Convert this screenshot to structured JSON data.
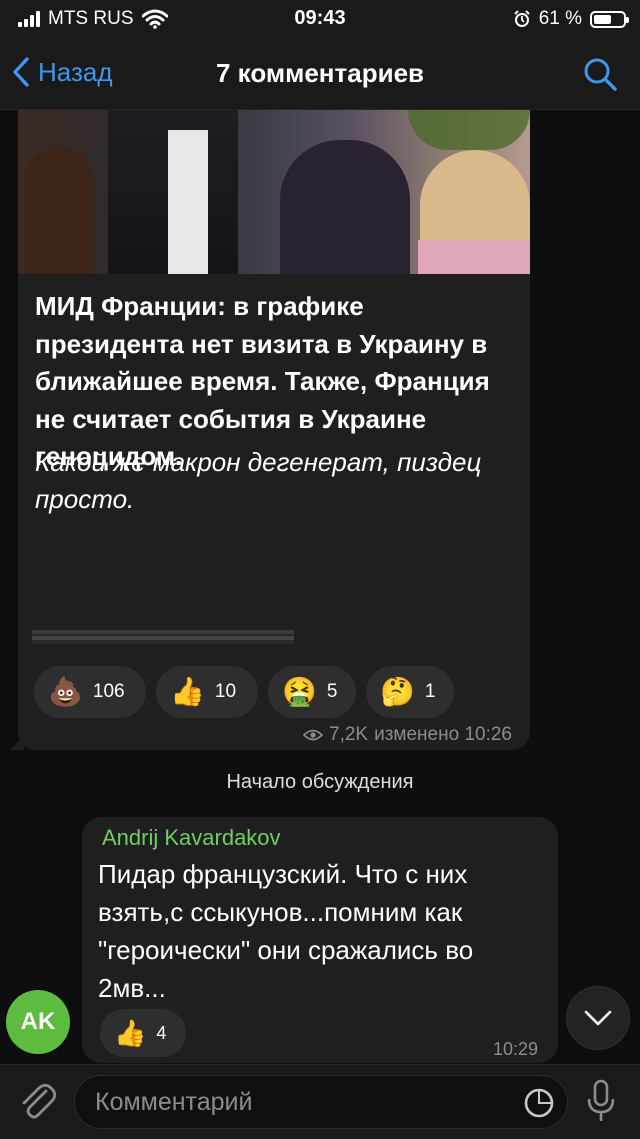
{
  "status_bar": {
    "carrier": "MTS RUS",
    "time": "09:43",
    "battery": "61 %",
    "battery_level": 0.61
  },
  "nav": {
    "back_label": "Назад",
    "title": "7 комментариев"
  },
  "post": {
    "text": "МИД Франции: в графике президента нет визита в Украину в ближайшее время. Также, Франция не считает события в Украине геноцидом.",
    "italic_text": "Какой же макрон дегенерат, пиздец просто.",
    "reactions": [
      {
        "emoji": "💩",
        "count": "106"
      },
      {
        "emoji": "👍",
        "count": "10"
      },
      {
        "emoji": "🤮",
        "count": "5"
      },
      {
        "emoji": "🤔",
        "count": "1"
      }
    ],
    "views": "7,2K",
    "edited": "изменено 10:26"
  },
  "discussion_label": "Начало обсуждения",
  "comment": {
    "avatar_initials": "AK",
    "avatar_color": "#5dbb3f",
    "author": "Andrij Kavardakov",
    "text": "Пидар французский. Что с них взять,с ссыкунов...помним как \"героически\" они сражались во 2мв...",
    "reaction_emoji": "👍",
    "reaction_count": "4",
    "time": "10:29"
  },
  "input": {
    "placeholder": "Комментарий"
  },
  "colors": {
    "accent": "#3e97ee",
    "author": "#6fcf62",
    "bubble": "#1f1f1f",
    "background": "#0e0e0e"
  }
}
